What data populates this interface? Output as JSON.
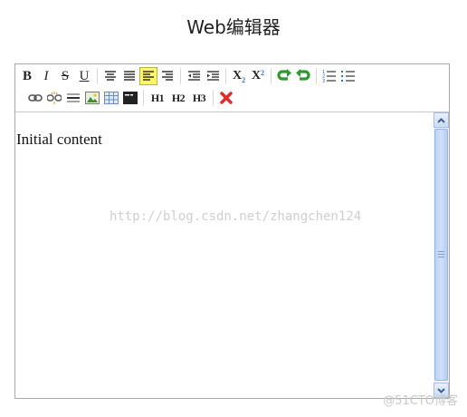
{
  "page": {
    "title": "Web编辑器"
  },
  "toolbar": {
    "bold": "B",
    "italic": "I",
    "strike": "S",
    "underline": "U",
    "subscript": "X",
    "subscript_mark": "2",
    "superscript": "X",
    "superscript_mark": "2",
    "h1": "H1",
    "h2": "H2",
    "h3": "H3",
    "active_tool": "align-left"
  },
  "editor": {
    "content": "Initial content",
    "watermark": "http://blog.csdn.net/zhangchen124"
  },
  "footer": {
    "watermark": "@51CTO博客"
  },
  "colors": {
    "active": "#fff76a",
    "redo_undo": "#2e9a2a",
    "delete": "#e22b2b",
    "scroll": "#bcd3f5"
  }
}
